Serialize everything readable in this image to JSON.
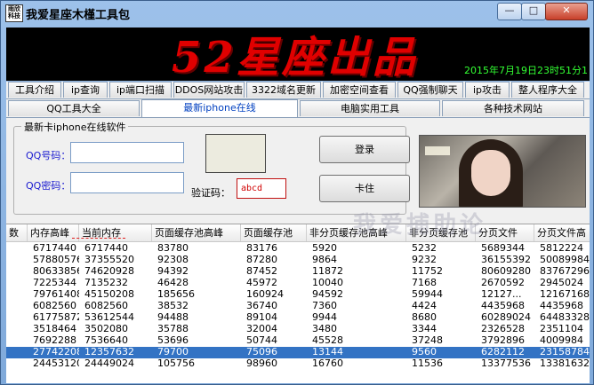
{
  "window": {
    "title": "我爱星座木槿工具包",
    "icon_text": "雨欣科技",
    "min": "—",
    "max": "□",
    "close": "✕"
  },
  "banner": {
    "title": "52星座出品",
    "time": "2015年7月19日23时51分1"
  },
  "tabs_row1": [
    "工具介绍",
    "ip查询",
    "ip端口扫描",
    "DDOS网站攻击",
    "3322域名更新",
    "加密空间查看",
    "QQ强制聊天",
    "ip攻击",
    "整人程序大全"
  ],
  "tabs_row2": [
    "QQ工具大全",
    "最新iphone在线",
    "电脑实用工具",
    "各种技术网站"
  ],
  "panel": {
    "group_title": "最新卡iphone在线软件",
    "qq_label": "QQ号码：",
    "pwd_label": "QQ密码：",
    "captcha_label": "验证码：",
    "captcha_value": "abcd",
    "login_button": "登录",
    "card_button": "卡住"
  },
  "table": {
    "columns": [
      "数",
      "内存高峰",
      "当前内存",
      "页面缓存池高峰",
      "页面缓存池",
      "非分页缓存池高峰",
      "非分页缓存池",
      "分页文件",
      "分页文件高"
    ],
    "rows": [
      [
        "",
        "6717440",
        "6717440",
        "83780",
        "83176",
        "5920",
        "5232",
        "5689344",
        "5812224"
      ],
      [
        "",
        "57880576",
        "37355520",
        "92308",
        "87280",
        "9864",
        "9232",
        "36155392",
        "50089984"
      ],
      [
        "",
        "80633856",
        "74620928",
        "94392",
        "87452",
        "11872",
        "11752",
        "80609280",
        "83767296"
      ],
      [
        "",
        "7225344",
        "7135232",
        "46428",
        "45972",
        "10040",
        "7168",
        "2670592",
        "2945024"
      ],
      [
        "",
        "79761408",
        "45150208",
        "185656",
        "160924",
        "94592",
        "59944",
        "12127...",
        "121671680"
      ],
      [
        "",
        "6082560",
        "6082560",
        "38532",
        "36740",
        "7360",
        "4424",
        "4435968",
        "4435968"
      ],
      [
        "",
        "61775872",
        "53612544",
        "94488",
        "89104",
        "9944",
        "8680",
        "60289024",
        "64483328"
      ],
      [
        "",
        "3518464",
        "3502080",
        "35788",
        "32004",
        "3480",
        "3344",
        "2326528",
        "2351104"
      ],
      [
        "",
        "7692288",
        "7536640",
        "53696",
        "50744",
        "45528",
        "37248",
        "3792896",
        "4009984"
      ],
      [
        "",
        "27742208",
        "12357632",
        "79700",
        "75096",
        "13144",
        "9560",
        "6282112",
        "23158784"
      ],
      [
        "",
        "24453120",
        "24449024",
        "105756",
        "98960",
        "16760",
        "11536",
        "13377536",
        "13381632"
      ]
    ],
    "selected_row": 9
  },
  "watermark": "我爱捕助论"
}
